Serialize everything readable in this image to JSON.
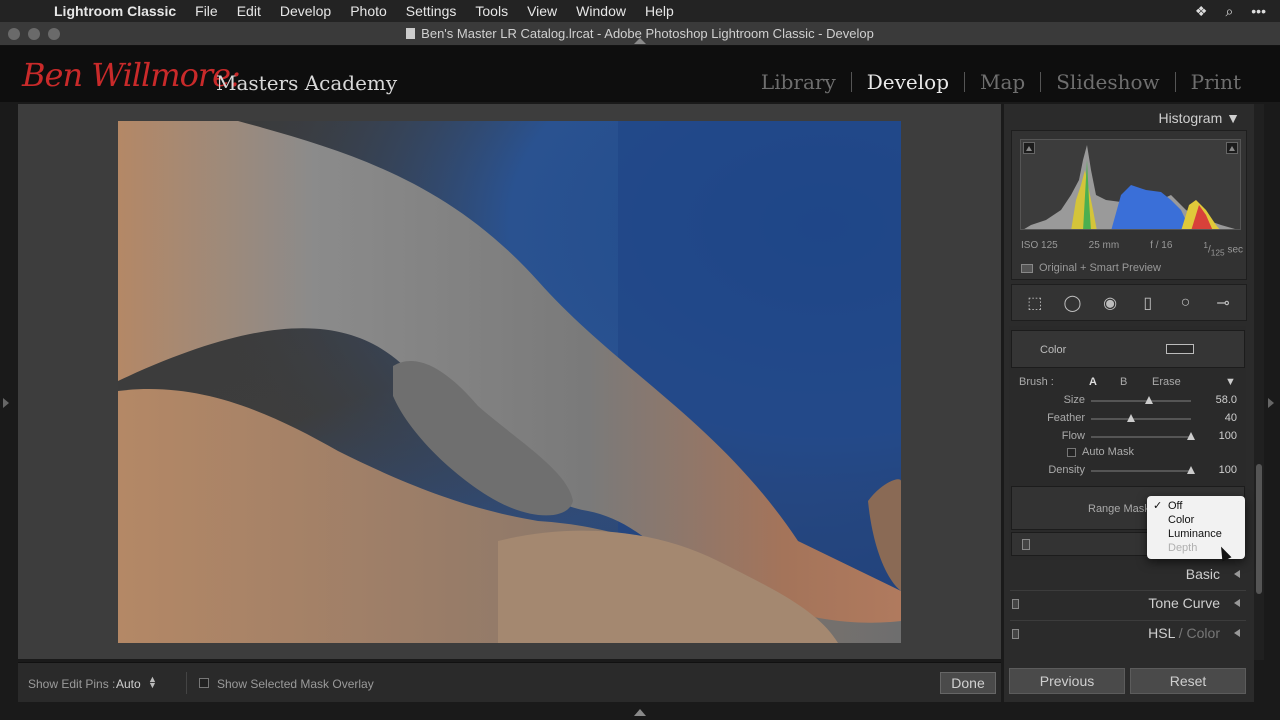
{
  "menubar": {
    "app_name": "Lightroom Classic",
    "items": [
      "File",
      "Edit",
      "Develop",
      "Photo",
      "Settings",
      "Tools",
      "View",
      "Window",
      "Help"
    ]
  },
  "window": {
    "title": "Ben's Master LR Catalog.lrcat - Adobe Photoshop Lightroom Classic - Develop"
  },
  "identity_plate": {
    "brand_script": "Ben Willmore:",
    "brand_text": "Masters Academy"
  },
  "modules": {
    "items": [
      "Library",
      "Develop",
      "Map",
      "Slideshow",
      "Print"
    ],
    "active": "Develop"
  },
  "histogram": {
    "title": "Histogram",
    "iso": "ISO 125",
    "focal": "25 mm",
    "aperture": "f / 16",
    "shutter_num": "1",
    "shutter_den": "125",
    "shutter_unit": "sec",
    "preview_label": "Original + Smart Preview"
  },
  "tools": [
    "crop-overlay-icon",
    "spot-removal-icon",
    "red-eye-icon",
    "graduated-filter-icon",
    "radial-filter-icon",
    "adjustment-brush-icon"
  ],
  "brush": {
    "color_label": "Color",
    "brush_label": "Brush :",
    "brush_a": "A",
    "brush_b": "B",
    "brush_erase": "Erase",
    "size_label": "Size",
    "size_value": "58.0",
    "size_frac": 0.58,
    "feather_label": "Feather",
    "feather_value": "40",
    "feather_frac": 0.4,
    "flow_label": "Flow",
    "flow_value": "100",
    "flow_frac": 1.0,
    "automask_label": "Auto Mask",
    "density_label": "Density",
    "density_value": "100",
    "density_frac": 1.0,
    "range_mask_label": "Range Mask"
  },
  "range_menu": {
    "options": [
      "Off",
      "Color",
      "Luminance",
      "Depth"
    ],
    "selected": "Off",
    "disabled": "Depth"
  },
  "sections": {
    "basic": "Basic",
    "tone_curve": "Tone Curve",
    "hsl": "HSL",
    "hsl_sep": " / ",
    "color": "Color"
  },
  "toolbar": {
    "show_edit_pins_label": "Show Edit Pins :",
    "show_edit_pins_value": "Auto",
    "mask_overlay_label": "Show Selected Mask Overlay",
    "done_label": "Done"
  },
  "buttons": {
    "previous": "Previous",
    "reset": "Reset"
  }
}
